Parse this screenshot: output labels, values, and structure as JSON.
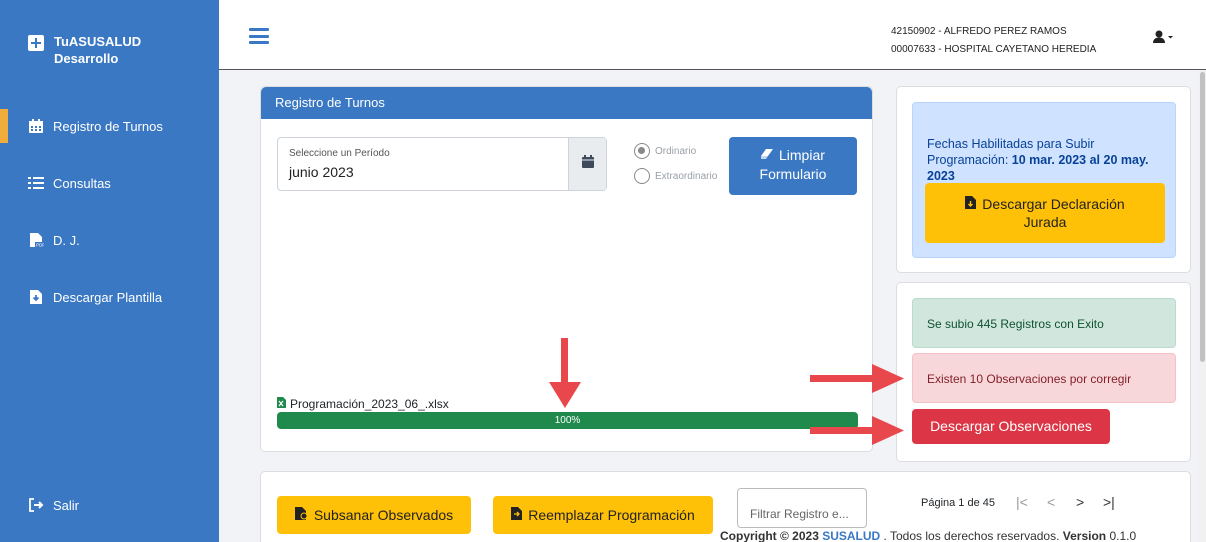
{
  "sidebar": {
    "brand_line1": "TuASUSALUD",
    "brand_line2": "Desarrollo",
    "items": [
      {
        "label": "Registro de Turnos",
        "icon": "calendar-icon",
        "active": true
      },
      {
        "label": "Consultas",
        "icon": "list-icon",
        "active": false
      },
      {
        "label": "D. J.",
        "icon": "pdf-file-icon",
        "active": false
      },
      {
        "label": "Descargar Plantilla",
        "icon": "download-file-icon",
        "active": false
      }
    ],
    "logout_label": "Salir"
  },
  "header": {
    "user_line": "42150902 - ALFREDO PEREZ RAMOS",
    "hospital_line": "00007633 - HOSPITAL CAYETANO HEREDIA"
  },
  "registro": {
    "title": "Registro de Turnos",
    "period_label": "Seleccione un Período",
    "period_value": "junio  2023",
    "radio_ordinario": "Ordinario",
    "radio_extraordinario": "Extraordinario",
    "clear_button_line1": "Limpiar",
    "clear_button_line2": "Formulario",
    "file_name": "Programación_2023_06_.xlsx",
    "progress_percent": 100,
    "progress_label": "100%"
  },
  "info": {
    "dates_text": "Fechas Habilitadas para Subir Programación: ",
    "dates_bold": "10 mar. 2023 al 20 may. 2023",
    "download_dj_line1": "Descargar Declaración",
    "download_dj_line2": "Jurada"
  },
  "status": {
    "success_text": "Se subio 445 Registros con Exito",
    "warning_text": "Existen 10 Observaciones por corregir",
    "download_obs_button": "Descargar Observaciones"
  },
  "actions": {
    "subsanar_button": "Subsanar Observados",
    "reemplazar_button": "Reemplazar Programación",
    "filter_placeholder": "Filtrar Registro e...",
    "page_info": "Página 1 de 45"
  },
  "footer": {
    "copyright": "Copyright © 2023 ",
    "brand": "SUSALUD",
    "rights": " . Todos los derechos reservados. ",
    "version_label": "Version",
    "version_value": " 0.1.0"
  },
  "colors": {
    "primary": "#3a78c4",
    "success": "#1f8a4c",
    "warning": "#ffc107",
    "danger": "#dc3545",
    "arrow": "#e8474c"
  }
}
